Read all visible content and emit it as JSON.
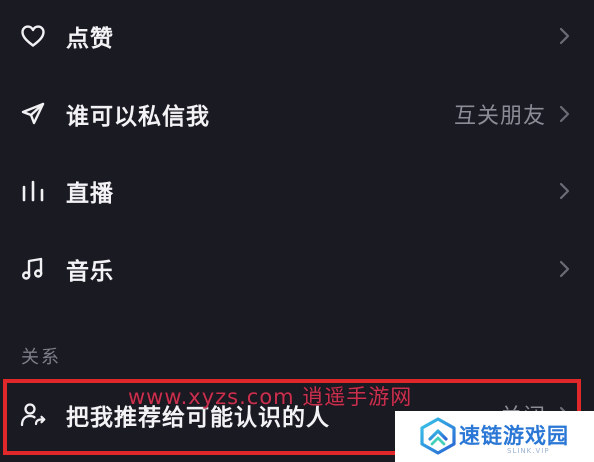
{
  "settings": {
    "items": [
      {
        "label": "点赞",
        "value": "",
        "icon": "heart-icon"
      },
      {
        "label": "谁可以私信我",
        "value": "互关朋友",
        "icon": "send-icon"
      },
      {
        "label": "直播",
        "value": "",
        "icon": "live-bars-icon"
      },
      {
        "label": "音乐",
        "value": "",
        "icon": "music-note-icon"
      }
    ],
    "section_relations": {
      "title": "关系",
      "item": {
        "label": "把我推荐给可能认识的人",
        "value": "关闭",
        "icon": "user-share-icon"
      }
    }
  },
  "overlay": {
    "watermark": "www.xyzs.com 逍遥手游网",
    "logo_name": "速链游戏园",
    "logo_sub": "SLINK.VIP"
  },
  "colors": {
    "background": "#1a1a23",
    "text_primary": "#f3f3f6",
    "text_secondary": "#8c8c96",
    "highlight_border": "#e0282a",
    "logo_blue": "#2a77d6"
  }
}
